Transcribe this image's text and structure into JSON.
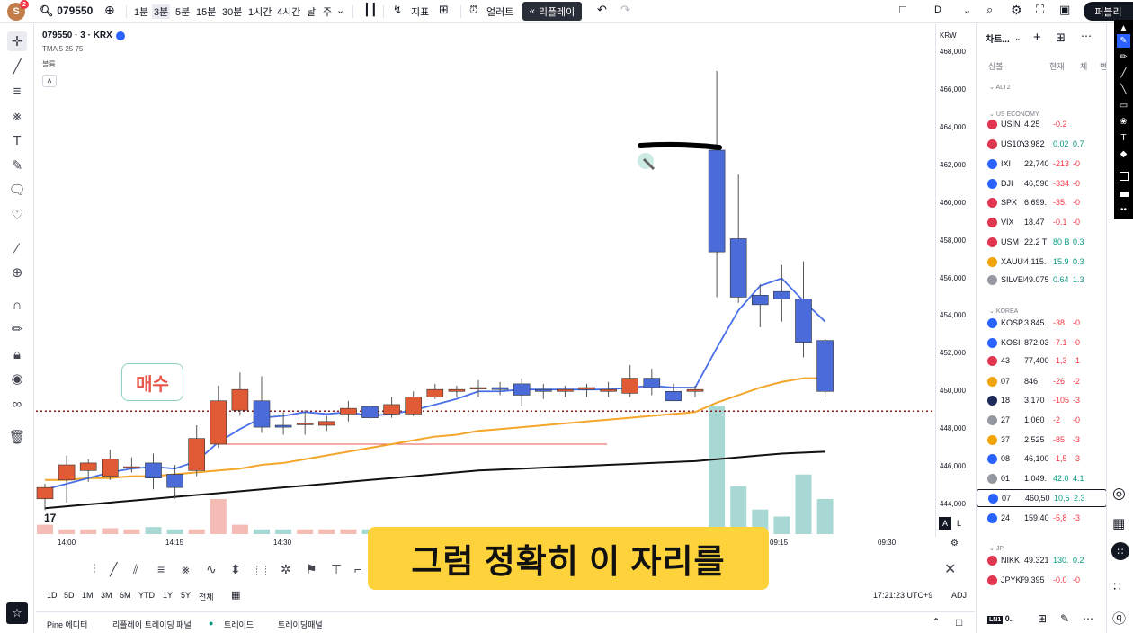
{
  "topbar": {
    "avatar_letter": "S",
    "avatar_badge": "2",
    "symbol": "079550",
    "intervals": [
      "1분",
      "3분",
      "5분",
      "15분",
      "30분",
      "1시간",
      "4시간",
      "날",
      "주"
    ],
    "indicators_label": "지표",
    "alert_label": "얼러트",
    "replay_label": "리플레이",
    "layout_label": "D",
    "publish_label": "퍼블리"
  },
  "legend": {
    "title": "079550 · 3 · KRX",
    "indicator": "TMA 5 25 75",
    "volume": "볼륨"
  },
  "price_axis": {
    "currency": "KRW",
    "ticks": [
      "468,000",
      "466,000",
      "464,000",
      "462,000",
      "460,000",
      "458,000",
      "456,000",
      "454,000",
      "452,000",
      "450,000",
      "448,000",
      "446,000",
      "444,000"
    ]
  },
  "time_axis": {
    "ticks": [
      "14:00",
      "14:15",
      "14:30",
      "09:15",
      "09:30"
    ]
  },
  "range_bar": {
    "ranges": [
      "1D",
      "5D",
      "1M",
      "3M",
      "6M",
      "YTD",
      "1Y",
      "5Y",
      "전체"
    ],
    "clock": "17:21:23 UTC+9",
    "adj": "ADJ"
  },
  "bottom_panel": {
    "tabs": [
      "Pine 에디터",
      "리플레이 트레이딩 패널",
      "트레이드",
      "트레이딩패널"
    ]
  },
  "annotations": {
    "buy_label": "매수",
    "caption": "그럼 정확히 이 자리를"
  },
  "watchlist": {
    "title": "차트...",
    "columns": [
      "심볼",
      "현재",
      "체",
      "변"
    ],
    "sections": [
      "ALT2",
      "US ECONOMY",
      "KOREA",
      "JP"
    ],
    "rows": [
      {
        "sym": "USIN",
        "last": "4.25",
        "chg": "-0.2",
        "pct": "",
        "color": "#e0364f"
      },
      {
        "sym": "US10Y",
        "last": "3.982",
        "chg": "0.02",
        "pct": "0.7",
        "color": "#e0364f"
      },
      {
        "sym": "IXI",
        "last": "22,740",
        "chg": "-213",
        "pct": "-0",
        "color": "#2962ff"
      },
      {
        "sym": "DJI",
        "last": "46,590",
        "chg": "-334",
        "pct": "-0",
        "color": "#2962ff"
      },
      {
        "sym": "SPX",
        "last": "6,699.",
        "chg": "-35.",
        "pct": "-0",
        "color": "#e0364f"
      },
      {
        "sym": "VIX",
        "last": "18.47",
        "chg": "-0.1",
        "pct": "-0",
        "color": "#e0364f"
      },
      {
        "sym": "USM",
        "last": "22.2 T",
        "chg": "80 B",
        "pct": "0.3",
        "color": "#e0364f"
      },
      {
        "sym": "XAUUS",
        "last": "4,115.",
        "chg": "15.9",
        "pct": "0.3",
        "color": "#f0a30a"
      },
      {
        "sym": "SILVER",
        "last": "49.075",
        "chg": "0.64",
        "pct": "1.3",
        "color": "#9598a1"
      },
      {
        "sym": "KOSP",
        "last": "3,845.",
        "chg": "-38.",
        "pct": "-0",
        "color": "#2962ff"
      },
      {
        "sym": "KOSI",
        "last": "872.03",
        "chg": "-7.1",
        "pct": "-0",
        "color": "#2962ff"
      },
      {
        "sym": "43",
        "last": "77,400",
        "chg": "-1,3",
        "pct": "-1",
        "color": "#e0364f"
      },
      {
        "sym": "07",
        "last": "846",
        "chg": "-26",
        "pct": "-2",
        "color": "#f0a30a"
      },
      {
        "sym": "18",
        "last": "3,170",
        "chg": "-105",
        "pct": "-3",
        "color": "#1e2a5a"
      },
      {
        "sym": "27",
        "last": "1,060",
        "chg": "-2",
        "pct": "-0",
        "color": "#9598a1"
      },
      {
        "sym": "37",
        "last": "2,525",
        "chg": "-85",
        "pct": "-3",
        "color": "#f0a30a"
      },
      {
        "sym": "08",
        "last": "46,100",
        "chg": "-1,5",
        "pct": "-3",
        "color": "#2962ff"
      },
      {
        "sym": "01",
        "last": "1,049.",
        "chg": "42.0",
        "pct": "4.1",
        "color": "#9598a1"
      },
      {
        "sym": "07",
        "last": "460,50",
        "chg": "10,5",
        "pct": "2.3",
        "color": "#2962ff"
      },
      {
        "sym": "24",
        "last": "159,40",
        "chg": "-5,8",
        "pct": "-3",
        "color": "#2962ff"
      },
      {
        "sym": "NIKK",
        "last": "49.321",
        "chg": "130.",
        "pct": "0.2",
        "color": "#e0364f"
      },
      {
        "sym": "JPYKR",
        "last": "9.395",
        "chg": "-0.0",
        "pct": "-0",
        "color": "#e0364f"
      }
    ],
    "footer_symbol": "0.."
  },
  "chart_data": {
    "type": "candlestick",
    "price_range": [
      443000,
      469000
    ],
    "ma_colors": {
      "fast": "#4a70e8",
      "mid": "#f4a62a",
      "slow": "#111111"
    },
    "up_color": "#e05a36",
    "down_color": "#4a6bd8",
    "hline_price": 448950,
    "candles": [
      {
        "o": 444300,
        "h": 445100,
        "l": 443700,
        "c": 444900,
        "v": 8
      },
      {
        "o": 445300,
        "h": 446600,
        "l": 444100,
        "c": 446100,
        "v": 4
      },
      {
        "o": 445800,
        "h": 446400,
        "l": 445200,
        "c": 446200,
        "v": 4
      },
      {
        "o": 445500,
        "h": 446900,
        "l": 445300,
        "c": 446400,
        "v": 5
      },
      {
        "o": 446000,
        "h": 446500,
        "l": 445700,
        "c": 446000,
        "v": 4
      },
      {
        "o": 446200,
        "h": 446700,
        "l": 444800,
        "c": 445400,
        "v": 6
      },
      {
        "o": 445600,
        "h": 446100,
        "l": 444300,
        "c": 444900,
        "v": 4
      },
      {
        "o": 445800,
        "h": 448200,
        "l": 445500,
        "c": 447500,
        "v": 4
      },
      {
        "o": 447200,
        "h": 450300,
        "l": 447000,
        "c": 449500,
        "v": 30
      },
      {
        "o": 449000,
        "h": 451000,
        "l": 448700,
        "c": 450100,
        "v": 8
      },
      {
        "o": 449500,
        "h": 450800,
        "l": 447800,
        "c": 448100,
        "v": 4
      },
      {
        "o": 448200,
        "h": 448900,
        "l": 447700,
        "c": 448100,
        "v": 4
      },
      {
        "o": 448300,
        "h": 449000,
        "l": 447700,
        "c": 448300,
        "v": 4
      },
      {
        "o": 448200,
        "h": 448700,
        "l": 447900,
        "c": 448400,
        "v": 4
      },
      {
        "o": 448800,
        "h": 449500,
        "l": 448400,
        "c": 449100,
        "v": 4
      },
      {
        "o": 449200,
        "h": 449400,
        "l": 448400,
        "c": 448600,
        "v": 4
      },
      {
        "o": 448800,
        "h": 449700,
        "l": 448600,
        "c": 449300,
        "v": 4
      },
      {
        "o": 448800,
        "h": 450000,
        "l": 448700,
        "c": 449700,
        "v": 4
      },
      {
        "o": 449700,
        "h": 450400,
        "l": 449600,
        "c": 450100,
        "v": 3
      },
      {
        "o": 450000,
        "h": 450300,
        "l": 449700,
        "c": 450100,
        "v": 3
      },
      {
        "o": 450200,
        "h": 450600,
        "l": 449700,
        "c": 450200,
        "v": 3
      },
      {
        "o": 450200,
        "h": 450500,
        "l": 449800,
        "c": 450100,
        "v": 3
      },
      {
        "o": 450400,
        "h": 450700,
        "l": 449200,
        "c": 449800,
        "v": 5
      },
      {
        "o": 450100,
        "h": 450400,
        "l": 449600,
        "c": 450000,
        "v": 3
      },
      {
        "o": 450000,
        "h": 450300,
        "l": 449700,
        "c": 450100,
        "v": 3
      },
      {
        "o": 450100,
        "h": 450400,
        "l": 449700,
        "c": 450200,
        "v": 3
      },
      {
        "o": 450000,
        "h": 450500,
        "l": 449700,
        "c": 450100,
        "v": 3
      },
      {
        "o": 449900,
        "h": 451400,
        "l": 449700,
        "c": 450700,
        "v": 4
      },
      {
        "o": 450700,
        "h": 451200,
        "l": 449800,
        "c": 450200,
        "v": 4
      },
      {
        "o": 450000,
        "h": 450400,
        "l": 449500,
        "c": 449500,
        "v": 4
      },
      {
        "o": 450000,
        "h": 450300,
        "l": 449700,
        "c": 450100,
        "v": 3
      },
      {
        "o": 462800,
        "h": 467000,
        "l": 455000,
        "c": 457400,
        "v": 110
      },
      {
        "o": 458100,
        "h": 461500,
        "l": 454700,
        "c": 455000,
        "v": 41
      },
      {
        "o": 455100,
        "h": 455700,
        "l": 453400,
        "c": 454600,
        "v": 21
      },
      {
        "o": 455300,
        "h": 456700,
        "l": 453700,
        "c": 454900,
        "v": 15
      },
      {
        "o": 454900,
        "h": 456900,
        "l": 451800,
        "c": 452600,
        "v": 51
      },
      {
        "o": 452700,
        "h": 452800,
        "l": 449700,
        "c": 450000,
        "v": 30
      }
    ],
    "ma_fast": [
      444800,
      445100,
      445400,
      445700,
      445900,
      446000,
      445900,
      446300,
      447300,
      448000,
      448600,
      448700,
      448900,
      448800,
      448900,
      448700,
      448800,
      449000,
      449300,
      449600,
      450000,
      450000,
      450100,
      450100,
      450100,
      450100,
      450100,
      450200,
      450300,
      450200,
      450200,
      452300,
      454300,
      455600,
      456000,
      454800,
      453700
    ],
    "ma_mid": [
      445300,
      445300,
      445400,
      445400,
      445500,
      445500,
      445600,
      445700,
      445800,
      445900,
      446100,
      446200,
      446400,
      446600,
      446800,
      447000,
      447200,
      447400,
      447600,
      447700,
      447900,
      448000,
      448100,
      448200,
      448300,
      448400,
      448500,
      448600,
      448700,
      448800,
      448900,
      449400,
      449800,
      450200,
      450500,
      450700,
      450700
    ],
    "ma_slow": [
      443800,
      443900,
      444000,
      444100,
      444200,
      444300,
      444400,
      444500,
      444600,
      444700,
      444800,
      444900,
      445000,
      445100,
      445200,
      445300,
      445400,
      445500,
      445600,
      445700,
      445800,
      445850,
      445900,
      445950,
      446000,
      446050,
      446100,
      446150,
      446200,
      446250,
      446300,
      446400,
      446500,
      446600,
      446700,
      446750,
      446800
    ]
  }
}
